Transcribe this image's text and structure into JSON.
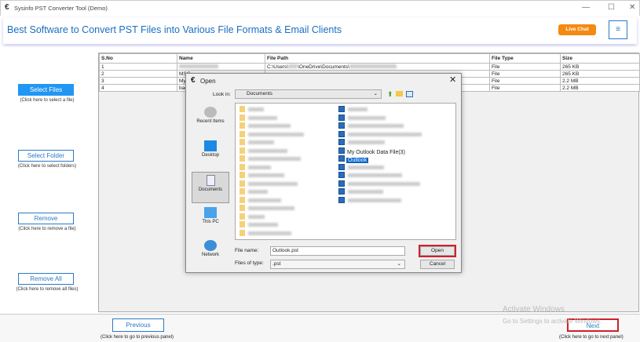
{
  "window": {
    "title": "Sysinfo PST Converter Tool (Demo)",
    "minimize": "—",
    "maximize": "☐",
    "close": "✕"
  },
  "header": {
    "headline": "Best Software to Convert PST Files into Various File Formats & Email Clients",
    "live_chat": "Live Chat",
    "menu": "≡"
  },
  "left": {
    "select_files": "Select Files",
    "select_files_hint": "(Click here to select a file)",
    "select_folder": "Select Folder",
    "select_folder_hint": "(Click here to select folders)",
    "remove": "Remove",
    "remove_hint": "(Click here to remove a file)",
    "remove_all": "Remove All",
    "remove_all_hint": "(Click here to remove all files)"
  },
  "table": {
    "headers": [
      "S.No",
      "Name",
      "File Path",
      "File Type",
      "Size"
    ],
    "rows": [
      {
        "sno": "1",
        "name": "",
        "path": "C:\\Users\\",
        "path2": "\\OneDrive\\Documents\\",
        "type": "File",
        "size": "265 KB"
      },
      {
        "sno": "2",
        "name": "MSG",
        "path": "",
        "path2": "",
        "type": "File",
        "size": "265 KB"
      },
      {
        "sno": "3",
        "name": "My",
        "path": "",
        "path2": "",
        "type": "File",
        "size": "2.2 MB"
      },
      {
        "sno": "4",
        "name": "bac",
        "path": "",
        "path2": "",
        "type": "File",
        "size": "2.2 MB"
      }
    ]
  },
  "dialog": {
    "title": "Open",
    "close": "✕",
    "look_in_label": "Look in:",
    "look_in": "Documents",
    "places": [
      "Recent Items",
      "Desktop",
      "Documents",
      "This PC",
      "Network"
    ],
    "visible_files": [
      "My Outlook Data File(3)",
      "Outlook"
    ],
    "file_name_label": "File name:",
    "file_name": "Outlook.pst",
    "file_type_label": "Files of type:",
    "file_type": ".pst",
    "open": "Open",
    "cancel": "Cancel"
  },
  "footer": {
    "previous": "Previous",
    "previous_hint": "(Click here to go to previous panel)",
    "next": "Next",
    "next_hint": "(Click here to go to next panel)"
  },
  "watermark": {
    "line1": "Activate Windows",
    "line2": "Go to Settings to activate Windows."
  },
  "colors": {
    "accent": "#2196f3",
    "live_chat": "#f58a12",
    "highlight": "#d0202a"
  }
}
